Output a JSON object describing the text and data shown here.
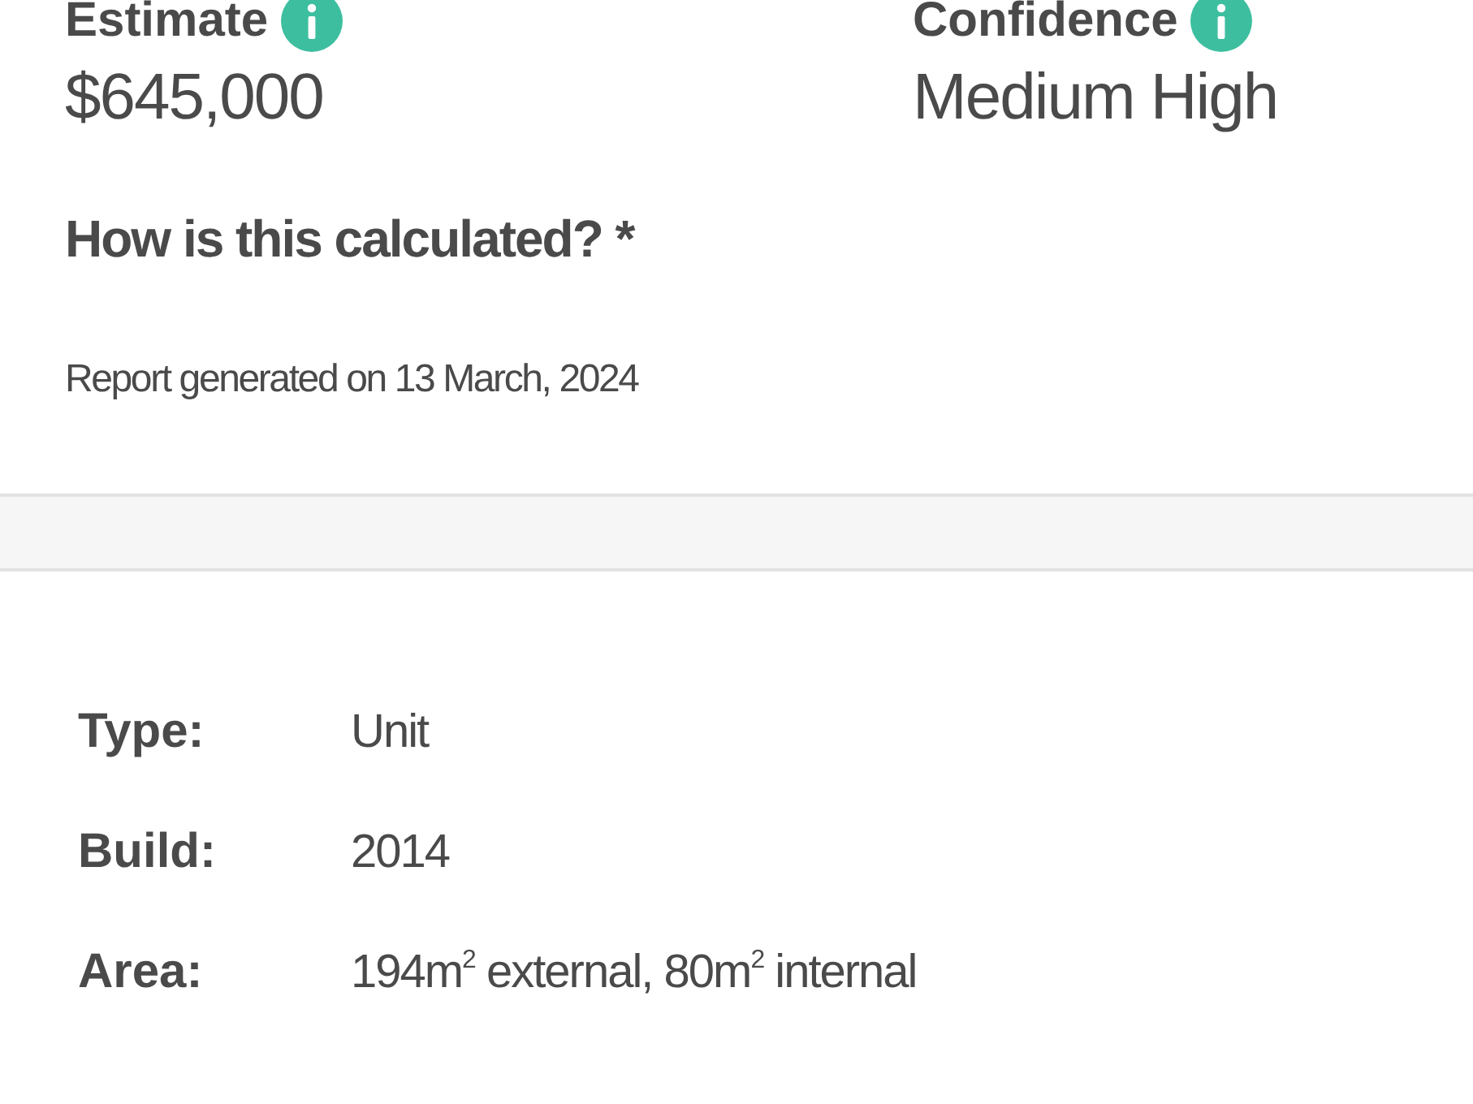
{
  "metrics": [
    {
      "label": "Estimate",
      "value": "$645,000"
    },
    {
      "label": "Confidence",
      "value": "Medium High"
    }
  ],
  "calculation_link": "How is this calculated? *",
  "report_date": "Report generated on 13 March, 2024",
  "details": [
    {
      "label": "Type:",
      "value": "Unit"
    },
    {
      "label": "Build:",
      "value": "2014"
    },
    {
      "label": "Area:",
      "value": "194m$^{2}$ external, 80m$^{2}$ internal"
    }
  ]
}
